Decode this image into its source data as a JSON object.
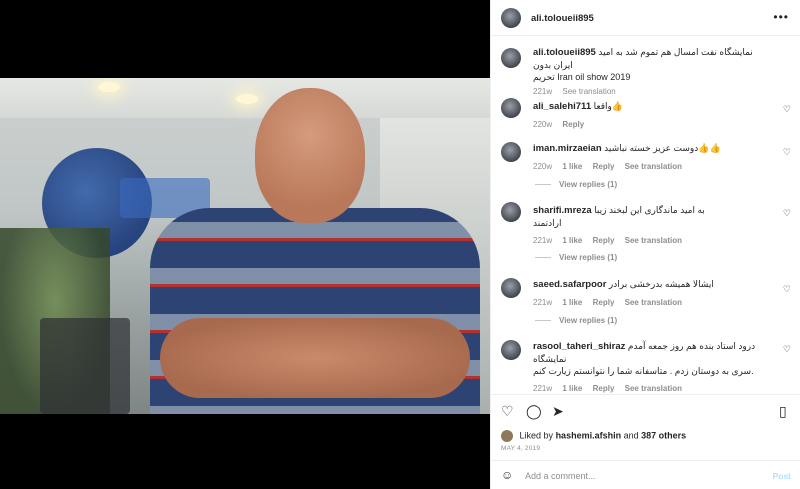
{
  "post": {
    "author": "ali.toloueii895",
    "caption_line1": "نمایشگاه نفت امسال هم تموم شد به امید ایران بدون",
    "caption_line2": "تحریم Iran oil show 2019",
    "caption_age": "221w",
    "caption_see_translation": "See translation"
  },
  "comments": [
    {
      "user": "ali_salehi711",
      "text": "واقعا👍",
      "age": "220w",
      "likes": "",
      "reply": "Reply",
      "translate": "",
      "replies": ""
    },
    {
      "user": "iman.mirzaeian",
      "text": "دوست عزیز خسته نباشید👍👍",
      "age": "220w",
      "likes": "1 like",
      "reply": "Reply",
      "translate": "See translation",
      "replies": "View replies (1)"
    },
    {
      "user": "sharifi.mreza",
      "text": "به امید ماندگاری این لبخند زیبا",
      "text2": "ارادتمند",
      "age": "221w",
      "likes": "1 like",
      "reply": "Reply",
      "translate": "See translation",
      "replies": "View replies (1)"
    },
    {
      "user": "saeed.safarpoor",
      "text": "ایشالا همیشه بدرخشی برادر",
      "age": "221w",
      "likes": "1 like",
      "reply": "Reply",
      "translate": "See translation",
      "replies": "View replies (1)"
    },
    {
      "user": "rasool_taheri_shiraz",
      "text": "درود استاد بنده هم روز جمعه آمدم نمایشگاه",
      "text2": "سری به دوستان زدم . متاسفانه شما را نتوانستم زیارت کنم.",
      "age": "221w",
      "likes": "1 like",
      "reply": "Reply",
      "translate": "See translation",
      "replies": ""
    }
  ],
  "likes": {
    "prefix": "Liked by",
    "user": "hashemi.afshin",
    "middle": "and",
    "others": "387 others"
  },
  "date": "MAY 4, 2019",
  "composer": {
    "placeholder": "Add a comment...",
    "post_label": "Post"
  },
  "icons": {
    "more": "more-icon",
    "heart": "heart-icon",
    "comment": "comment-icon",
    "share": "share-icon",
    "save": "bookmark-icon",
    "emoji": "emoji-icon"
  }
}
